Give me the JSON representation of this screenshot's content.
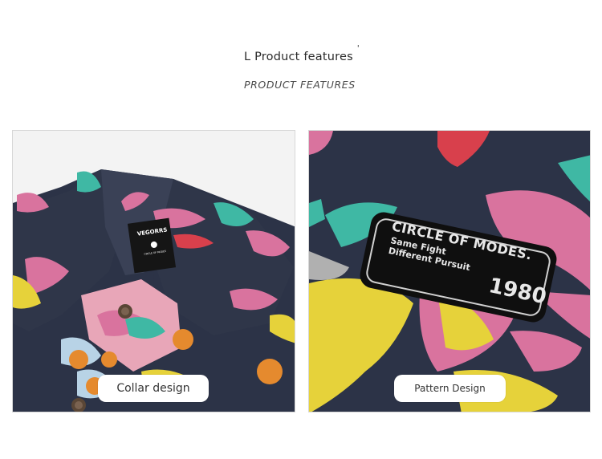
{
  "header": {
    "title": "L Product features",
    "title_mark": "'",
    "subtitle": "PRODUCT FEATURES"
  },
  "left_panel": {
    "caption": "Collar design",
    "label": {
      "brand": "VEGORRS",
      "tagline": "CIRCLE OF MODES"
    }
  },
  "right_panel": {
    "caption": "Pattern Design",
    "badge": {
      "line1": "CIRCLE OF MODES.",
      "line2": "Same Fight",
      "line3": "Different Pursuit",
      "year": "1980"
    }
  },
  "colors": {
    "fabric_navy": "#2c3347",
    "pink": "#d9739e",
    "teal": "#3fb8a4",
    "yellow": "#e6d23a",
    "red": "#d8404c",
    "orange": "#e58a2e",
    "light_blue": "#b8d3e6"
  }
}
